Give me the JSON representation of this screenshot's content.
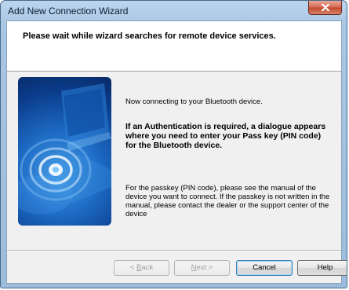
{
  "window": {
    "title": "Add New Connection Wizard"
  },
  "header": {
    "title": "Please wait while wizard searches for remote device services."
  },
  "content": {
    "status": "Now connecting to your Bluetooth device.",
    "notice": "If an Authentication is required, a dialogue appears where you need to enter your Pass key (PIN code) for the Bluetooth device.",
    "help_text": "For the passkey (PIN code), please see the manual of the device you want to connect. If the passkey is not written in the manual, please contact the dealer or the support center of the device"
  },
  "buttons": {
    "back": {
      "mnemonic": "B",
      "rest": "ack",
      "prefix": "< "
    },
    "next": {
      "mnemonic": "N",
      "rest": "ext >"
    },
    "cancel": "Cancel",
    "help": "Help"
  },
  "colors": {
    "banner_dark": "#0b3d8c",
    "banner_light": "#4aa0e6",
    "close_red": "#c24a30"
  },
  "icons": {
    "close": "close-icon",
    "banner": "bluetooth-laptop-illustration"
  }
}
